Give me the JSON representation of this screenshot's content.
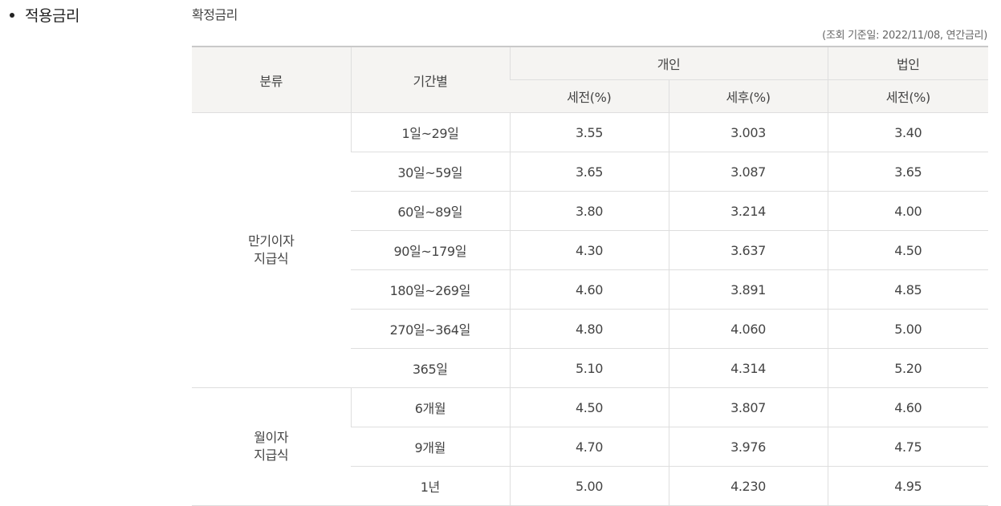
{
  "section_title": "적용금리",
  "sub_title": "확정금리",
  "reference_note": "(조회 기준일: 2022/11/08, 연간금리)",
  "table": {
    "headers": {
      "category": "분류",
      "period": "기간별",
      "individual": "개인",
      "corporate": "법인",
      "pretax": "세전(%)",
      "aftertax": "세후(%)",
      "corp_pretax": "세전(%)"
    },
    "groups": [
      {
        "category": [
          "만기이자",
          "지급식"
        ],
        "rows": [
          {
            "period": "1일~29일",
            "pretax": "3.55",
            "aftertax": "3.003",
            "corp_pretax": "3.40"
          },
          {
            "period": "30일~59일",
            "pretax": "3.65",
            "aftertax": "3.087",
            "corp_pretax": "3.65"
          },
          {
            "period": "60일~89일",
            "pretax": "3.80",
            "aftertax": "3.214",
            "corp_pretax": "4.00"
          },
          {
            "period": "90일~179일",
            "pretax": "4.30",
            "aftertax": "3.637",
            "corp_pretax": "4.50"
          },
          {
            "period": "180일~269일",
            "pretax": "4.60",
            "aftertax": "3.891",
            "corp_pretax": "4.85"
          },
          {
            "period": "270일~364일",
            "pretax": "4.80",
            "aftertax": "4.060",
            "corp_pretax": "5.00"
          },
          {
            "period": "365일",
            "pretax": "5.10",
            "aftertax": "4.314",
            "corp_pretax": "5.20"
          }
        ]
      },
      {
        "category": [
          "월이자",
          "지급식"
        ],
        "rows": [
          {
            "period": "6개월",
            "pretax": "4.50",
            "aftertax": "3.807",
            "corp_pretax": "4.60"
          },
          {
            "period": "9개월",
            "pretax": "4.70",
            "aftertax": "3.976",
            "corp_pretax": "4.75"
          },
          {
            "period": "1년",
            "pretax": "5.00",
            "aftertax": "4.230",
            "corp_pretax": "4.95"
          }
        ]
      }
    ]
  }
}
